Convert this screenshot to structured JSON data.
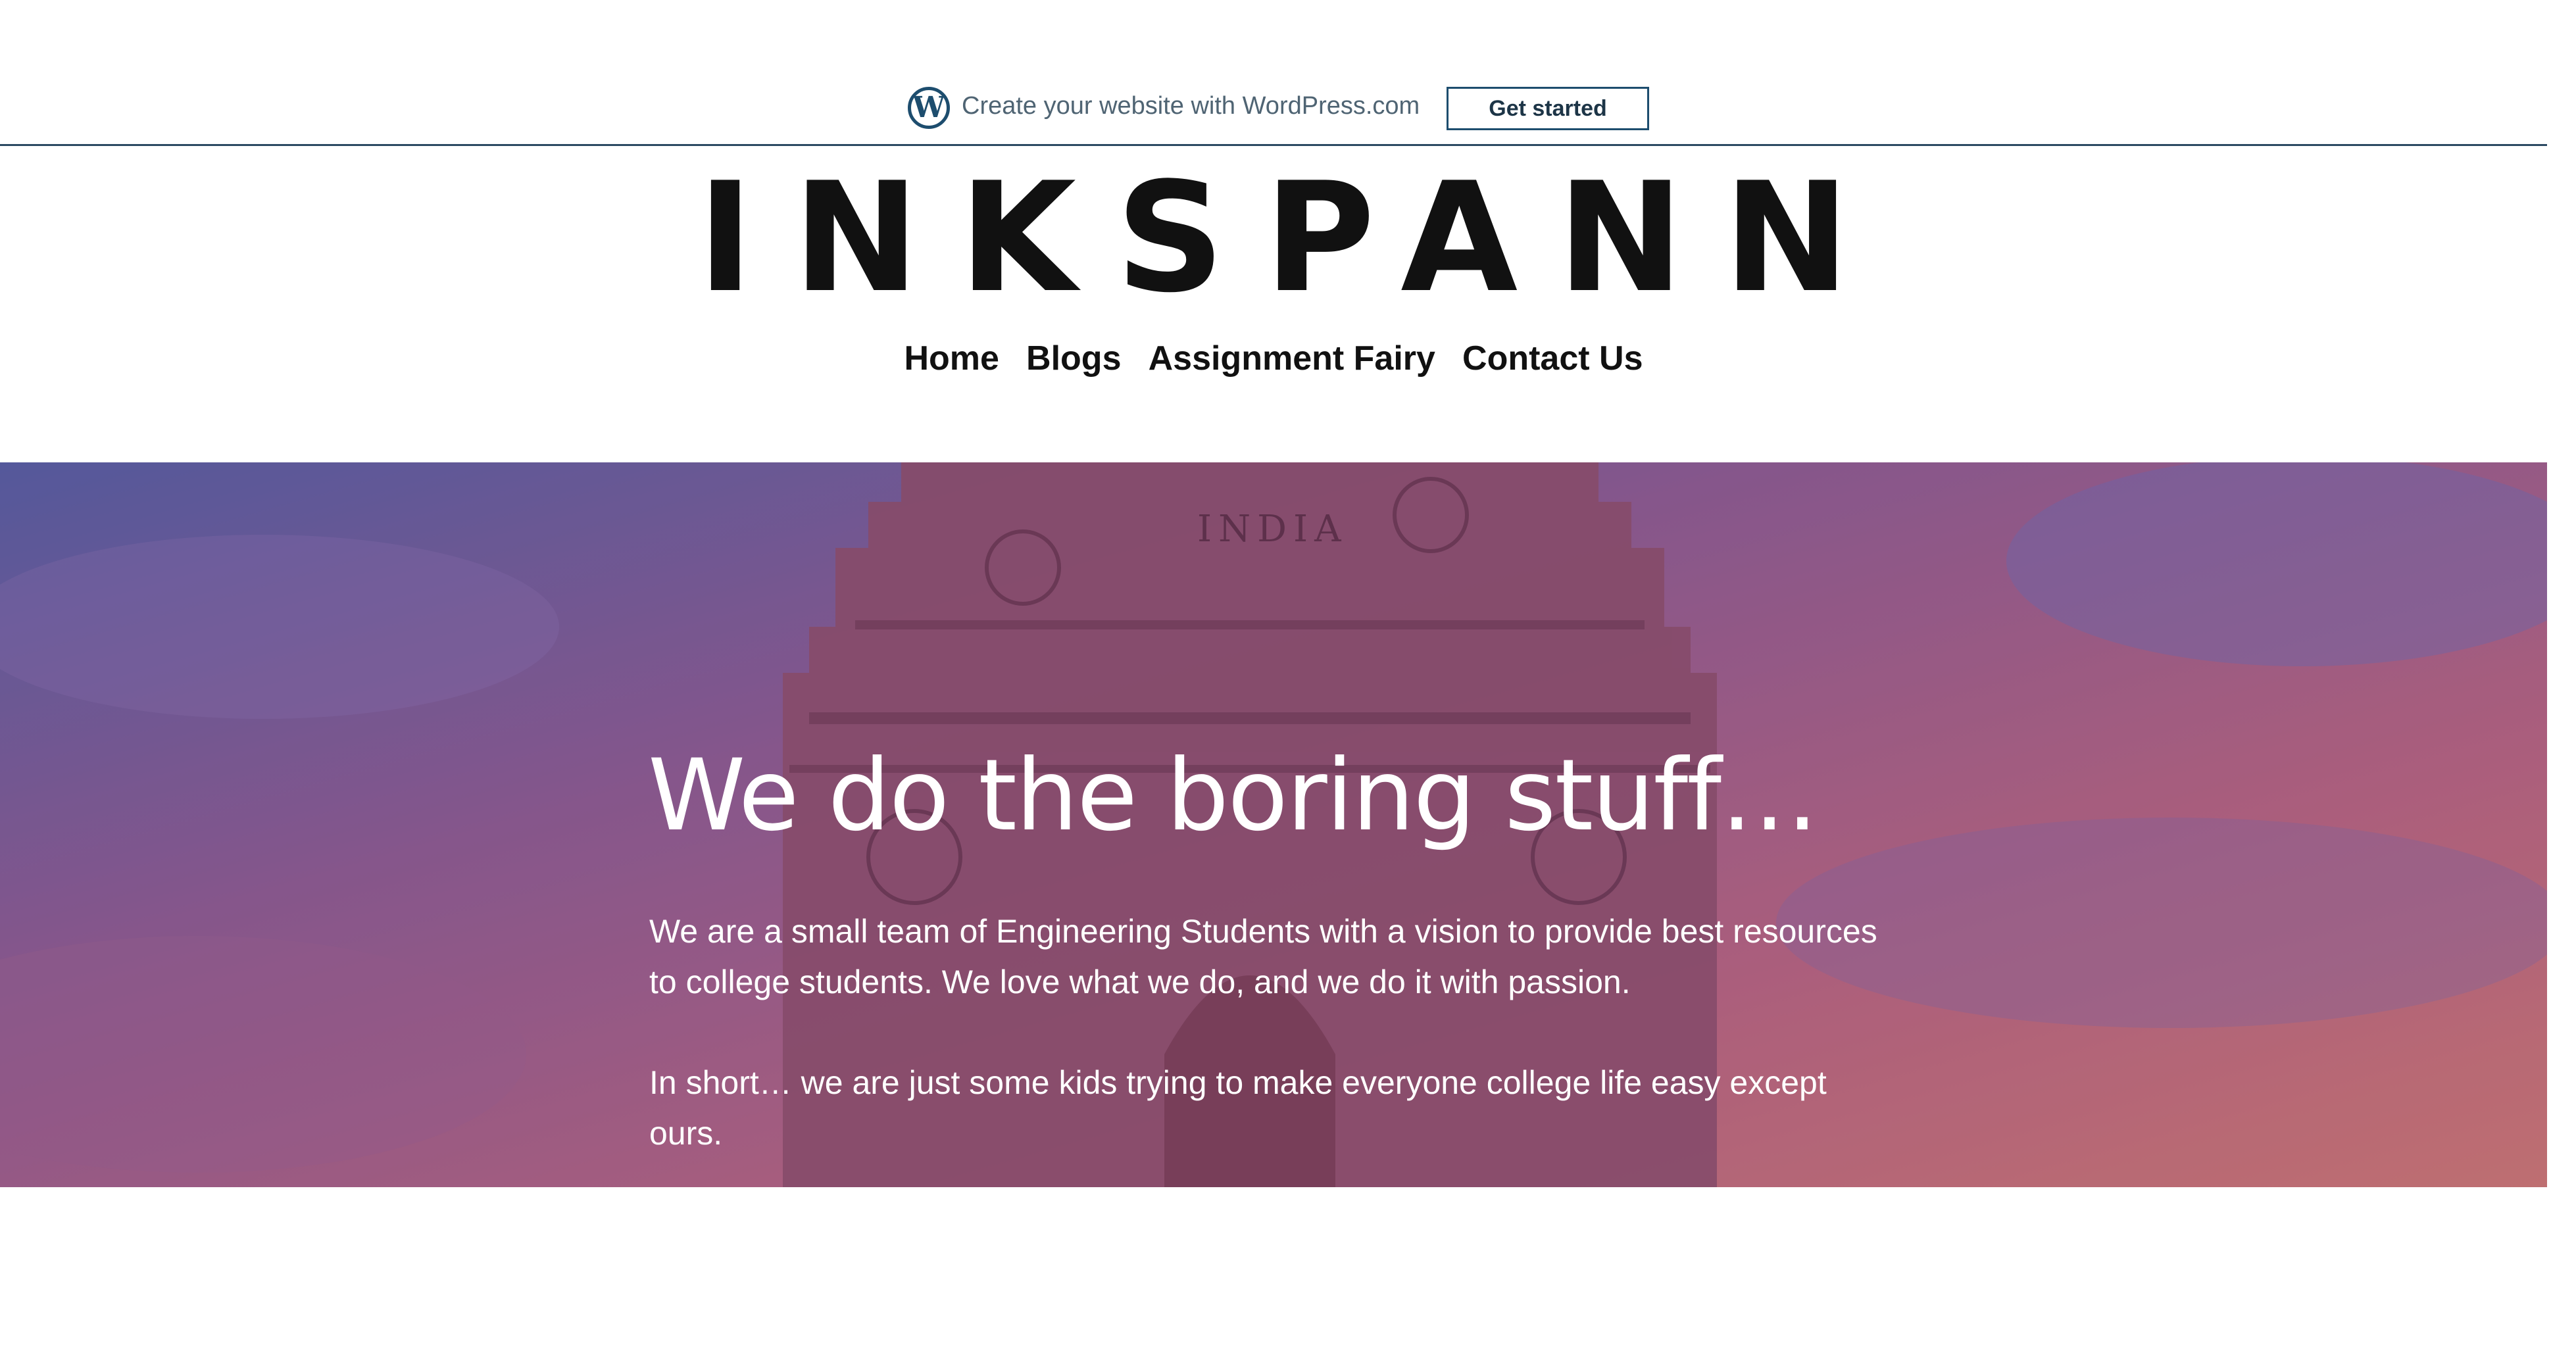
{
  "wp_banner": {
    "text": "Create your website with WordPress.com",
    "button": "Get started",
    "logo_icon": "wordpress-logo-icon",
    "logo_glyph": "W"
  },
  "site": {
    "title": "INKSPANN"
  },
  "nav": {
    "items": [
      {
        "label": "Home"
      },
      {
        "label": "Blogs"
      },
      {
        "label": "Assignment Fairy"
      },
      {
        "label": "Contact Us"
      }
    ]
  },
  "hero": {
    "heading": "We do the boring stuff…",
    "paragraph1": "We are a small team of Engineering Students with a vision to provide best resources to college students. We love what we do, and we do it with passion.",
    "paragraph2": "In short… we are just some kids trying to make everyone college life easy except ours.",
    "image_inscription": "INDIA"
  },
  "colors": {
    "accent": "#1d4d6e",
    "text_dark": "#111111",
    "hero_sky_top": "#5a5f9e",
    "hero_sky_bottom": "#c0707a"
  }
}
